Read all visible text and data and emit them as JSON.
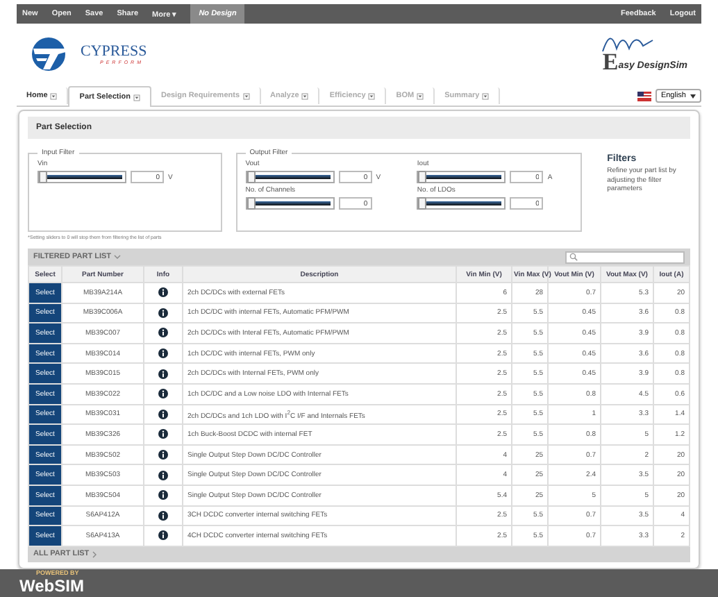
{
  "top_bar": {
    "menu": [
      {
        "label": "New"
      },
      {
        "label": "Open"
      },
      {
        "label": "Save"
      },
      {
        "label": "Share"
      },
      {
        "label": "More ▾"
      }
    ],
    "design_name": "No Design",
    "right_links": [
      {
        "label": "Feedback"
      },
      {
        "label": "Logout"
      }
    ]
  },
  "header": {
    "company_name": "CYPRESS",
    "company_tagline": "PERFORM",
    "product_name": "asy DesignSim",
    "product_initial": "E"
  },
  "tabs": [
    {
      "label": "Home",
      "selected": false,
      "disabled": false
    },
    {
      "label": "Part Selection",
      "selected": true,
      "disabled": false
    },
    {
      "label": "Design Requirements",
      "selected": false,
      "disabled": true
    },
    {
      "label": "Analyze",
      "selected": false,
      "disabled": true
    },
    {
      "label": "Efficiency",
      "selected": false,
      "disabled": true
    },
    {
      "label": "BOM",
      "selected": false,
      "disabled": true
    },
    {
      "label": "Summary",
      "selected": false,
      "disabled": true
    }
  ],
  "language": {
    "value": "English"
  },
  "panel_title": "Part Selection",
  "input_filter": {
    "legend": "Input Filter",
    "sliders": [
      {
        "label": "Vin",
        "level": 0,
        "value": "0",
        "unit": "V"
      }
    ]
  },
  "output_filter": {
    "legend": "Output Filter",
    "sliders": [
      {
        "label": "Vout",
        "level": 0,
        "value": "0",
        "unit": "V"
      },
      {
        "label": "Iout",
        "level": 0,
        "value": "0",
        "unit": "A"
      },
      {
        "label": "No. of Channels",
        "level": 0,
        "value": "0"
      },
      {
        "label": "No. of LDOs",
        "level": 0,
        "value": "0"
      }
    ]
  },
  "filter_note": "*Setting sliders to 0 will stop them from filtering the list of parts",
  "filters_help": {
    "title": "Filters",
    "text": "Refine your part list by adjusting the filter parameters"
  },
  "part_list": {
    "title": "FILTERED PART LIST",
    "columns": [
      "Select",
      "Part Number",
      "Info",
      "Description",
      "Vin Min (V)",
      "Vin Max (V)",
      "Vout Min (V)",
      "Vout Max (V)",
      "Iout (A)"
    ],
    "rows": [
      {
        "select": "Select",
        "part": "MB39A214A",
        "description": "2ch DC/DCs with external FETs",
        "values": [
          "6",
          "28",
          "0.7",
          "5.3",
          "20"
        ]
      },
      {
        "select": "Select",
        "part": "MB39C006A",
        "description": "1ch DC/DC with internal FETs, Automatic PFM/PWM",
        "values": [
          "2.5",
          "5.5",
          "0.45",
          "3.6",
          "0.8"
        ]
      },
      {
        "select": "Select",
        "part": "MB39C007",
        "description": "2ch DC/DCs with Interal FETs, Automatic PFM/PWM",
        "values": [
          "2.5",
          "5.5",
          "0.45",
          "3.9",
          "0.8"
        ]
      },
      {
        "select": "Select",
        "part": "MB39C014",
        "description": "1ch DC/DC with internal FETs, PWM only",
        "values": [
          "2.5",
          "5.5",
          "0.45",
          "3.6",
          "0.8"
        ]
      },
      {
        "select": "Select",
        "part": "MB39C015",
        "description": "2ch DC/DCs with Internal FETs, PWM only",
        "values": [
          "2.5",
          "5.5",
          "0.45",
          "3.9",
          "0.8"
        ]
      },
      {
        "select": "Select",
        "part": "MB39C022",
        "description": "1ch DC/DC and a Low noise LDO with Internal FETs",
        "values": [
          "2.5",
          "5.5",
          "0.8",
          "4.5",
          "0.6"
        ]
      },
      {
        "select": "Select",
        "part": "MB39C031",
        "description": "2ch DC/DCs and 1ch LDO with I$^{2}$C I/F and Internals FETs",
        "values": [
          "2.5",
          "5.5",
          "1",
          "3.3",
          "1.4"
        ]
      },
      {
        "select": "Select",
        "part": "MB39C326",
        "description": "1ch Buck-Boost DCDC with internal FET",
        "values": [
          "2.5",
          "5.5",
          "0.8",
          "5",
          "1.2"
        ]
      },
      {
        "select": "Select",
        "part": "MB39C502",
        "description": "Single Output Step Down DC/DC Controller",
        "values": [
          "4",
          "25",
          "0.7",
          "2",
          "20"
        ]
      },
      {
        "select": "Select",
        "part": "MB39C503",
        "description": "Single Output Step Down DC/DC Controller",
        "values": [
          "4",
          "25",
          "2.4",
          "3.5",
          "20"
        ]
      },
      {
        "select": "Select",
        "part": "MB39C504",
        "description": "Single Output Step Down DC/DC Controller",
        "values": [
          "5.4",
          "25",
          "5",
          "5",
          "20"
        ]
      },
      {
        "select": "Select",
        "part": "S6AP412A",
        "description": "3CH DCDC converter internal switching FETs",
        "values": [
          "2.5",
          "5.5",
          "0.7",
          "3.5",
          "4"
        ]
      },
      {
        "select": "Select",
        "part": "S6AP413A",
        "description": "4CH DCDC converter internal switching FETs",
        "values": [
          "2.5",
          "5.5",
          "0.7",
          "3.3",
          "2"
        ]
      }
    ],
    "footer": "ALL PART LIST"
  },
  "footer": {
    "powered_by": "POWERED BY",
    "brand": "WebSIM"
  }
}
